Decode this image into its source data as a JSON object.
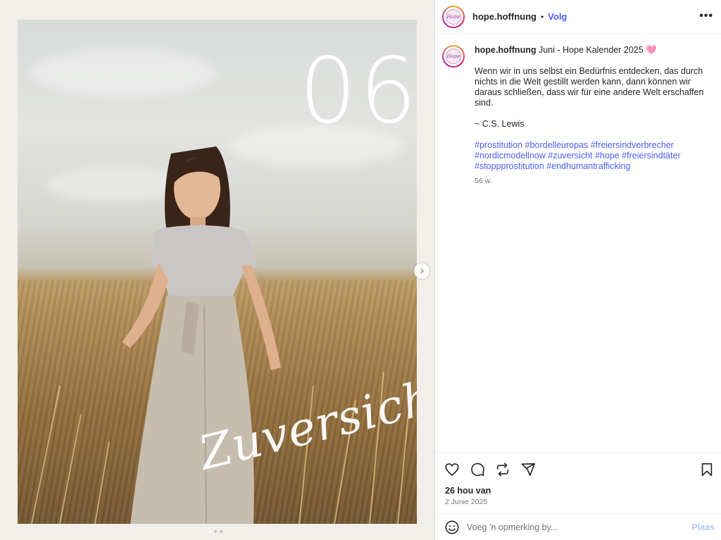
{
  "media": {
    "overlay_number": "06",
    "overlay_word": "Zuversicht",
    "carousel": {
      "count": 3,
      "active_index": 0
    }
  },
  "post_header": {
    "avatar_label": "Hope",
    "username": "hope.hoffnung",
    "separator": "•",
    "follow_label": "Volg",
    "more_icon": "more-horizontal-icon"
  },
  "caption": {
    "username": "hope.hoffnung",
    "title": "Juni - Hope Kalender 2025",
    "title_emoji": "🩷",
    "quote": "Wenn wir in uns selbst ein Bedürfnis entdecken, das durch nichts in die Welt gestillt werden kann, dann können wir daraus schließen, dass wir für eine andere Welt erschaffen sind.",
    "author": "~ C.S. Lewis",
    "hashtags": [
      "#prostitution",
      "#bordelleuropas",
      "#freiersindverbrecher",
      "#nordicmodellnow",
      "#zuversicht",
      "#hope",
      "#freiersindtäter",
      "#stoppprostitution",
      "#endhumantrafficking"
    ],
    "age": "56 w."
  },
  "actions": {
    "likes": "26 hou van",
    "date": "2 Junie 2025"
  },
  "comment": {
    "placeholder": "Voeg 'n opmerking by...",
    "post_label": "Plaas"
  },
  "colors": {
    "link": "#4a5df9",
    "post_disabled": "#b3c7fc",
    "muted": "#737373"
  }
}
